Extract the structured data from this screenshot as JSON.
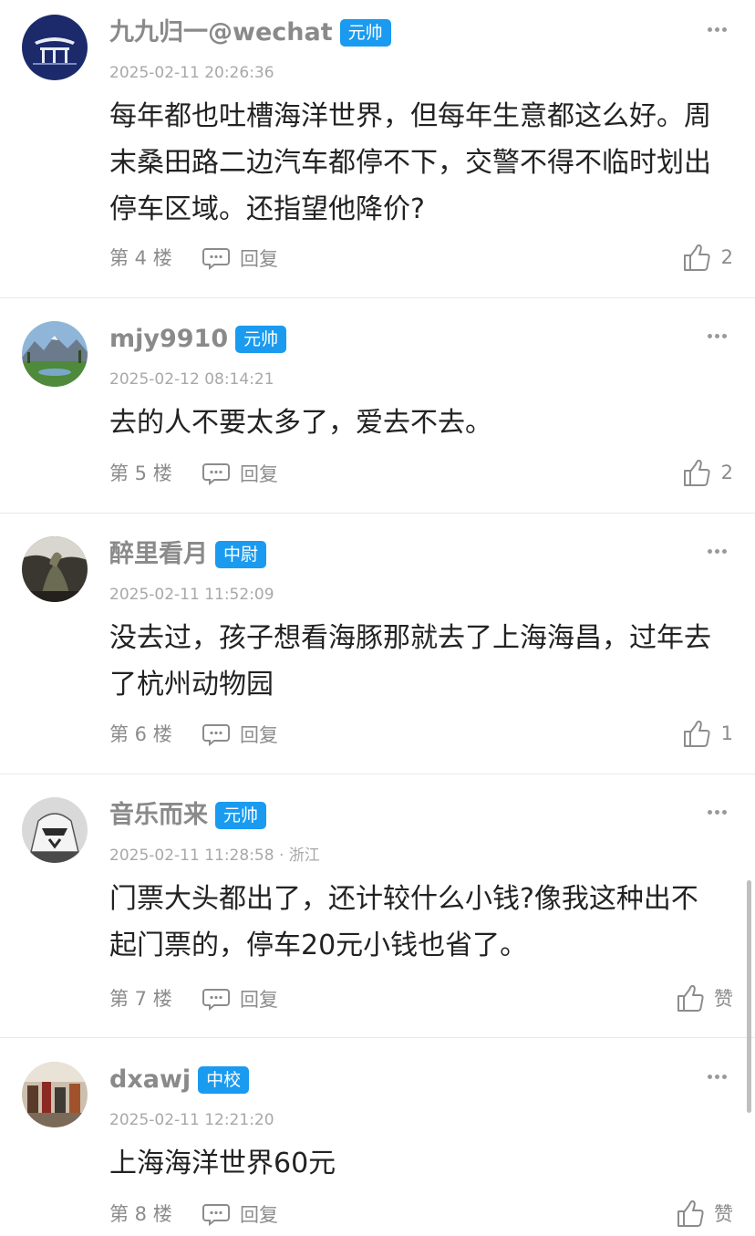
{
  "comments": [
    {
      "username": "九九归一@wechat",
      "rank": "元帅",
      "timestamp": "2025-02-11 20:26:36",
      "text": "每年都也吐槽海洋世界，但每年生意都这么好。周末桑田路二边汽车都停不下，交警不得不临时划出停车区域。还指望他降价?",
      "floor": "第 4 楼",
      "reply": "回复",
      "likes": "2"
    },
    {
      "username": "mjy9910",
      "rank": "元帅",
      "timestamp": "2025-02-12 08:14:21",
      "text": "去的人不要太多了，爱去不去。",
      "floor": "第 5 楼",
      "reply": "回复",
      "likes": "2"
    },
    {
      "username": "醉里看月",
      "rank": "中尉",
      "timestamp": "2025-02-11 11:52:09",
      "text": "没去过，孩子想看海豚那就去了上海海昌，过年去了杭州动物园",
      "floor": "第 6 楼",
      "reply": "回复",
      "likes": "1"
    },
    {
      "username": "音乐而来",
      "rank": "元帅",
      "timestamp": "2025-02-11 11:28:58 · 浙江",
      "text": "门票大头都出了，还计较什么小钱?像我这种出不起门票的，停车20元小钱也省了。",
      "floor": "第 7 楼",
      "reply": "回复",
      "likes": "赞"
    },
    {
      "username": "dxawj",
      "rank": "中校",
      "timestamp": "2025-02-11 12:21:20",
      "text": "上海海洋世界60元",
      "floor": "第 8 楼",
      "reply": "回复",
      "likes": "赞"
    }
  ],
  "icons": {
    "more": "more-dots-icon",
    "reply": "comment-bubble-icon",
    "like": "thumbs-up-icon"
  },
  "colors": {
    "rank_badge": "#1a9bf0",
    "username": "#8a8a8a",
    "meta": "#a8a8a8",
    "text": "#222222"
  }
}
